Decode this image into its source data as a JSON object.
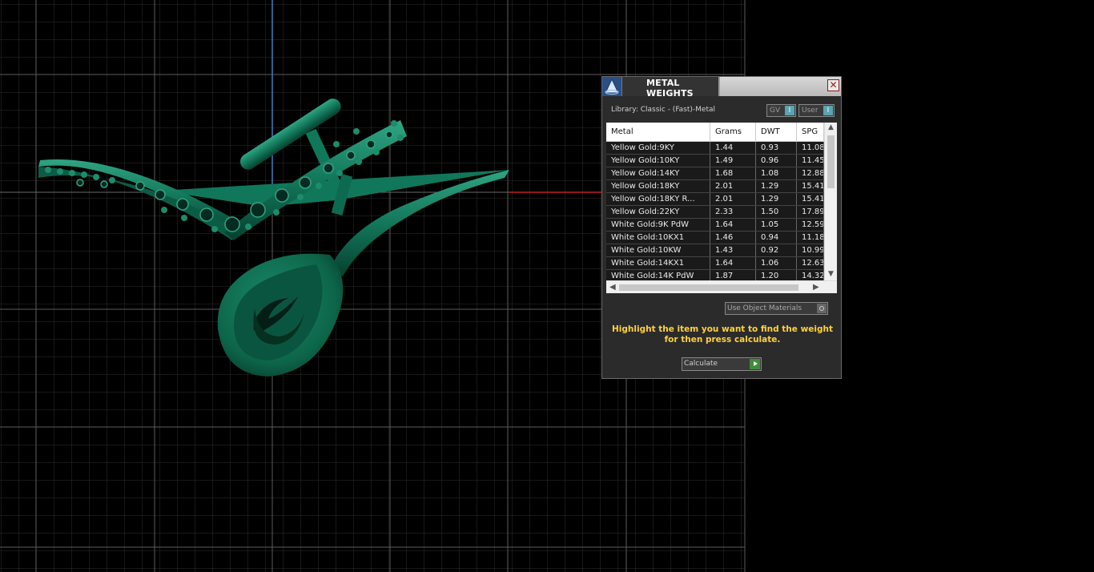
{
  "dialog": {
    "title": "METAL WEIGHTS",
    "close_glyph": "✕",
    "library_label": "Library: Classic - (Fast)-Metal",
    "toggles": [
      {
        "label": "GV",
        "knob": "I"
      },
      {
        "label": "User",
        "knob": "I"
      }
    ],
    "table": {
      "columns": [
        "Metal",
        "Grams",
        "DWT",
        "SPG"
      ],
      "rows": [
        [
          "Yellow Gold:9KY",
          "1.44",
          "0.93",
          "11.08"
        ],
        [
          "Yellow Gold:10KY",
          "1.49",
          "0.96",
          "11.45"
        ],
        [
          "Yellow Gold:14KY",
          "1.68",
          "1.08",
          "12.88"
        ],
        [
          "Yellow Gold:18KY",
          "2.01",
          "1.29",
          "15.41"
        ],
        [
          "Yellow Gold:18KY R...",
          "2.01",
          "1.29",
          "15.41"
        ],
        [
          "Yellow Gold:22KY",
          "2.33",
          "1.50",
          "17.89"
        ],
        [
          "White Gold:9K PdW",
          "1.64",
          "1.05",
          "12.59"
        ],
        [
          "White Gold:10KX1",
          "1.46",
          "0.94",
          "11.18"
        ],
        [
          "White Gold:10KW",
          "1.43",
          "0.92",
          "10.99"
        ],
        [
          "White Gold:14KX1",
          "1.64",
          "1.06",
          "12.63"
        ],
        [
          "White Gold:14K PdW",
          "1.87",
          "1.20",
          "14.32"
        ]
      ]
    },
    "use_object_materials": "Use Object Materials",
    "hint": "Highlight the item you want to find the weight for then press calculate.",
    "calculate_label": "Calculate"
  },
  "colors": {
    "model": "#0e6b4f",
    "grid": "#3b3b3b",
    "hint": "#ffd23c"
  }
}
